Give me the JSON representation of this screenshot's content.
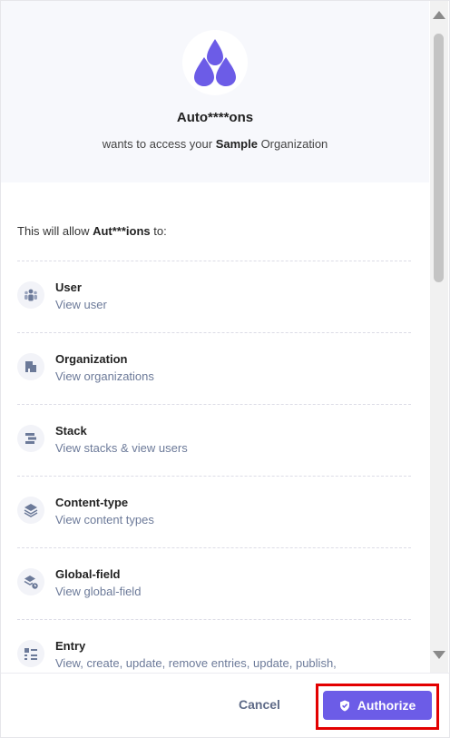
{
  "header": {
    "app_name": "Auto****ons",
    "subtitle_prefix": "wants to access your ",
    "org_name": "Sample",
    "subtitle_suffix": " Organization"
  },
  "intro": {
    "prefix": "This will allow ",
    "app_name": "Aut***ions",
    "suffix": " to:"
  },
  "permissions": [
    {
      "icon": "users-icon",
      "title": "User",
      "desc": "View user"
    },
    {
      "icon": "building-icon",
      "title": "Organization",
      "desc": "View organizations"
    },
    {
      "icon": "stack-icon",
      "title": "Stack",
      "desc": "View stacks & view users"
    },
    {
      "icon": "layers-icon",
      "title": "Content-type",
      "desc": "View content types"
    },
    {
      "icon": "global-field-icon",
      "title": "Global-field",
      "desc": "View global-field"
    },
    {
      "icon": "entry-list-icon",
      "title": "Entry",
      "desc": "View, create, update, remove entries, update, publish,"
    }
  ],
  "footer": {
    "cancel_label": "Cancel",
    "authorize_label": "Authorize"
  },
  "colors": {
    "accent": "#6c5ce7",
    "highlight": "#e30000",
    "muted_text": "#6c7a99"
  }
}
